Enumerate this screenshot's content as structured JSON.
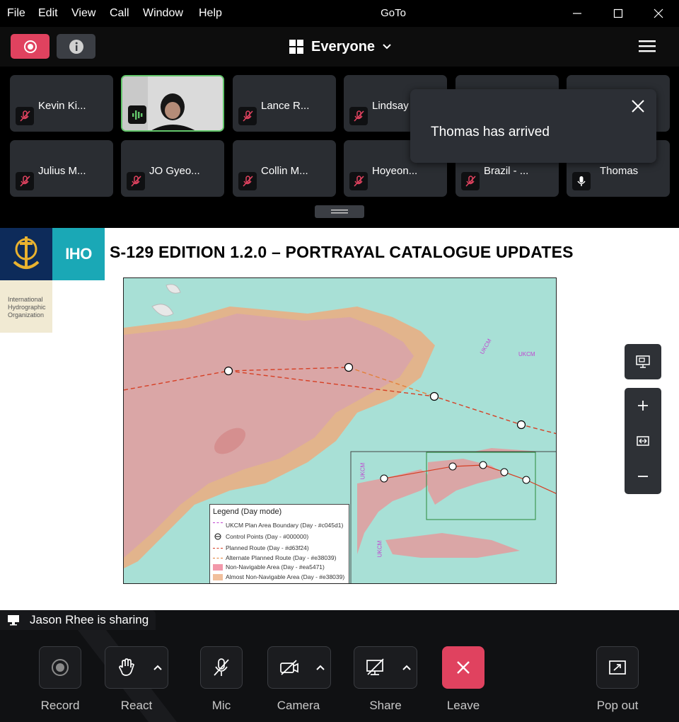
{
  "window": {
    "title": "GoTo",
    "menu": [
      "File",
      "Edit",
      "View",
      "Call",
      "Window",
      "Help"
    ]
  },
  "toolbar": {
    "view_label": "Everyone"
  },
  "participants": [
    {
      "name": "Kevin Ki...",
      "mic": "muted"
    },
    {
      "name": "",
      "mic": "speaking",
      "video": true
    },
    {
      "name": "Lance R...",
      "mic": "muted"
    },
    {
      "name": "Lindsay",
      "mic": "muted"
    },
    {
      "name": "",
      "mic": "hidden"
    },
    {
      "name": "",
      "mic": "hidden"
    },
    {
      "name": "Julius M...",
      "mic": "muted"
    },
    {
      "name": "JO Gyeo...",
      "mic": "muted"
    },
    {
      "name": "Collin M...",
      "mic": "muted"
    },
    {
      "name": "Hoyeon...",
      "mic": "muted"
    },
    {
      "name": "Brazil - ...",
      "mic": "muted"
    },
    {
      "name": "Thomas",
      "mic": "on"
    }
  ],
  "toast": {
    "message": "Thomas has arrived"
  },
  "slide": {
    "org_short": "IHO",
    "org_full": "International Hydrographic Organization",
    "title": "S-129 EDITION 1.2.0 – PORTRAYAL CATALOGUE UPDATES",
    "legend": {
      "title": "Legend (Day mode)",
      "items": [
        {
          "label": "UKCM Plan Area Boundary (Day - #c045d1)",
          "color": "#c045d1",
          "kind": "boundary"
        },
        {
          "label": "Control Points (Day - #000000)",
          "color": "#000000",
          "kind": "point"
        },
        {
          "label": "Planned Route (Day - #d63f24)",
          "color": "#d63f24",
          "kind": "route"
        },
        {
          "label": "Alternate Planned Route (Day - #e38039)",
          "color": "#e38039",
          "kind": "alt-route"
        },
        {
          "label": "Non-Navigable Area (Day - #ea5471)",
          "color": "#ea5471",
          "kind": "fill"
        },
        {
          "label": "Almost Non-Navigable Area (Day - #e38039)",
          "color": "#e38039",
          "kind": "fill"
        }
      ]
    },
    "map_labels": [
      "UKCM",
      "UKCM",
      "UKCM",
      "UKCM"
    ]
  },
  "sharing": {
    "text": "Jason Rhee is sharing"
  },
  "controls": [
    {
      "label": "Record",
      "icon": "record-icon"
    },
    {
      "label": "React",
      "icon": "hand-icon"
    },
    {
      "label": "Mic",
      "icon": "mic-off-icon"
    },
    {
      "label": "Camera",
      "icon": "camera-off-icon"
    },
    {
      "label": "Share",
      "icon": "share-screen-icon"
    },
    {
      "label": "Leave",
      "icon": "leave-icon"
    },
    {
      "label": "Pop out",
      "icon": "pop-out-icon"
    }
  ],
  "colors": {
    "record": "#e0425f",
    "leave": "#e0425f",
    "speaking": "#63c66b",
    "iho_navy": "#0d2b5a",
    "iho_teal": "#1aa8b6",
    "sea": "#a8e0d6",
    "land": "#d9a7a7"
  }
}
